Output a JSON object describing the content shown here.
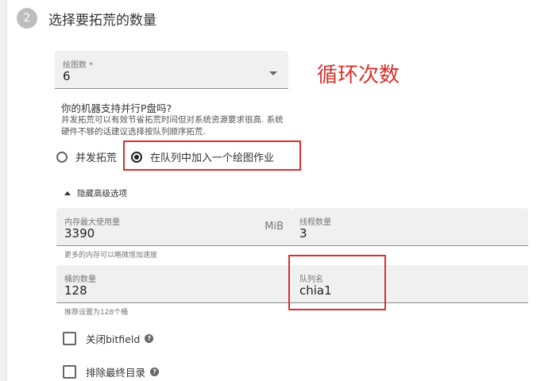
{
  "step": {
    "number": "2",
    "title": "选择要拓荒的数量"
  },
  "plot_count": {
    "label": "绘图数 *",
    "value": "6"
  },
  "annotation": "循环次数",
  "parallel": {
    "question": "你的机器支持并行P盘吗?",
    "description": "并发拓荒可以有效节省拓荒时间但对系统资源要求很高. 系统硬件不够的话建议选择按队列顺序拓荒.",
    "options": [
      {
        "label": "并发拓荒",
        "selected": false
      },
      {
        "label": "在队列中加入一个绘图作业",
        "selected": true
      }
    ]
  },
  "advanced_toggle": "隐藏高级选项",
  "memory": {
    "label": "内存最大使用量",
    "value": "3390",
    "unit": "MiB",
    "helper": "更多的内存可以略微增加速度"
  },
  "threads": {
    "label": "线程数量",
    "value": "3"
  },
  "buckets": {
    "label": "桶的数量",
    "value": "128",
    "helper": "推荐设置为128个桶"
  },
  "queue": {
    "label": "队列名",
    "value": "chia1"
  },
  "checkboxes": [
    {
      "label": "关闭bitfield",
      "checked": false
    },
    {
      "label": "排除最终目录",
      "checked": false
    }
  ],
  "colors": {
    "annotation_red": "#d9302c",
    "field_bg": "#f0f0f0"
  },
  "icons": {
    "help": "help-icon",
    "dropdown": "chevron-down-icon",
    "toggle": "chevron-up-icon"
  }
}
